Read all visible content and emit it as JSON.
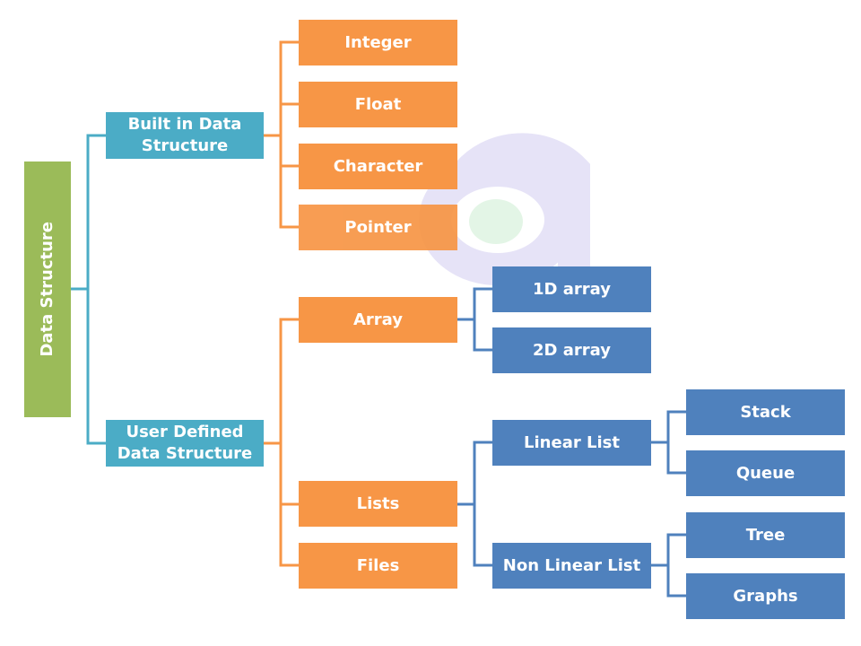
{
  "colors": {
    "root": "#9BBB59",
    "level1": "#4BACC6",
    "level2": "#F79646",
    "level3": "#4F81BD"
  },
  "root": {
    "label": "Data Structure"
  },
  "built_in": {
    "label": "Built in Data Structure",
    "children": [
      "Integer",
      "Float",
      "Character",
      "Pointer"
    ]
  },
  "user_defined": {
    "label": "User Defined Data Structure",
    "children": [
      "Array",
      "Lists",
      "Files"
    ]
  },
  "array": {
    "children": [
      "1D array",
      "2D array"
    ]
  },
  "lists": {
    "children": [
      "Linear List",
      "Non Linear List"
    ]
  },
  "linear_list": {
    "children": [
      "Stack",
      "Queue"
    ]
  },
  "non_linear_list": {
    "children": [
      "Tree",
      "Graphs"
    ]
  }
}
